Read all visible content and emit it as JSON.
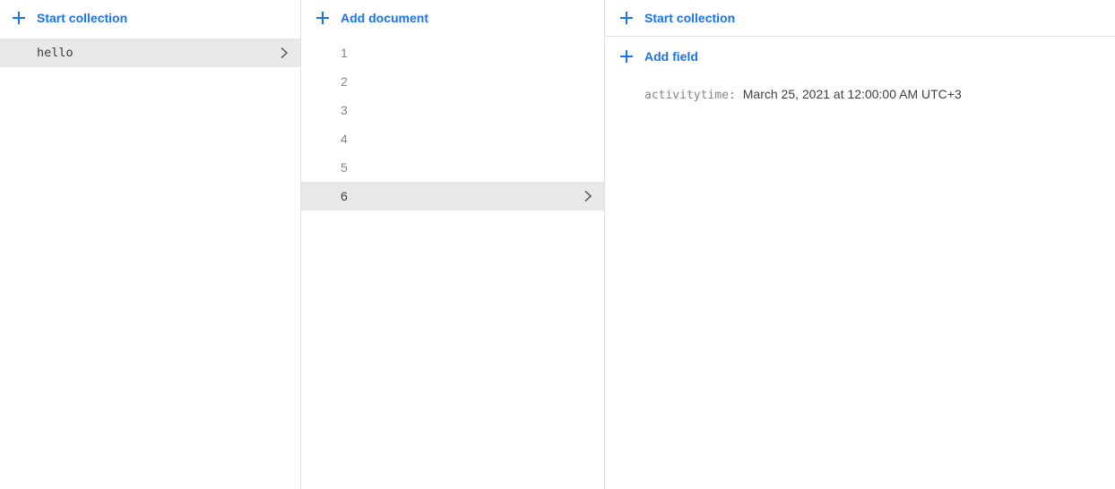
{
  "collections_panel": {
    "action_label": "Start collection",
    "items": [
      {
        "label": "hello"
      }
    ]
  },
  "documents_panel": {
    "action_label": "Add document",
    "items": [
      {
        "label": "1"
      },
      {
        "label": "2"
      },
      {
        "label": "3"
      },
      {
        "label": "4"
      },
      {
        "label": "5"
      },
      {
        "label": "6"
      }
    ]
  },
  "fields_panel": {
    "start_collection_label": "Start collection",
    "add_field_label": "Add field",
    "fields": [
      {
        "key": "activitytime:",
        "value": "March 25, 2021 at 12:00:00 AM UTC+3"
      }
    ]
  },
  "colors": {
    "accent": "#1a73e8",
    "selected_row": "#e8e8e8",
    "divider": "#e0e0e0"
  },
  "icons": [
    "plus-icon",
    "chevron-right-icon"
  ]
}
